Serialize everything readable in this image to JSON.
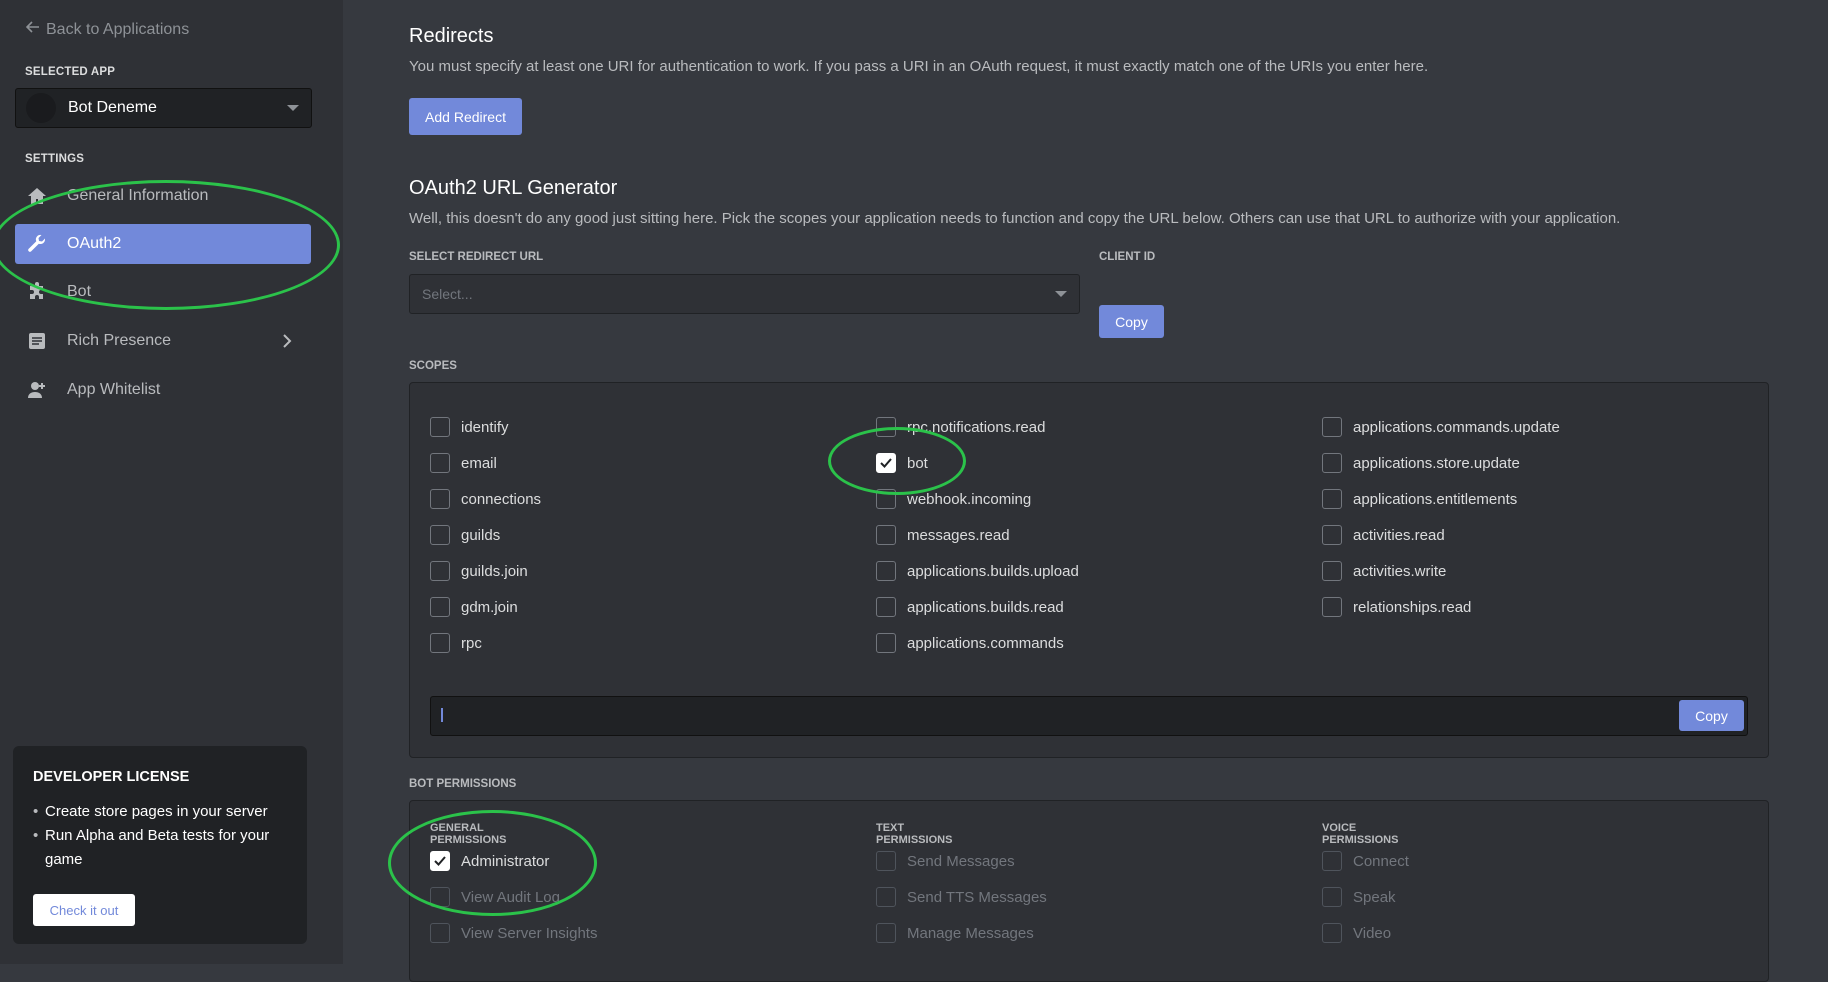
{
  "sidebar": {
    "back_label": "Back to Applications",
    "selected_app_label": "SELECTED APP",
    "app_name": "Bot Deneme",
    "settings_label": "SETTINGS",
    "items": [
      {
        "label": "General Information",
        "icon": "home-icon"
      },
      {
        "label": "OAuth2",
        "icon": "wrench-icon",
        "active": true
      },
      {
        "label": "Bot",
        "icon": "puzzle-icon"
      },
      {
        "label": "Rich Presence",
        "icon": "document-icon"
      },
      {
        "label": "App Whitelist",
        "icon": "person-add-icon"
      }
    ],
    "dev_license": {
      "title": "DEVELOPER LICENSE",
      "bullets": [
        "Create store pages in your server",
        "Run Alpha and Beta tests for your game"
      ],
      "button": "Check it out"
    }
  },
  "redirects": {
    "title": "Redirects",
    "description": "You must specify at least one URI for authentication to work. If you pass a URI in an OAuth request, it must exactly match one of the URIs you enter here.",
    "add_button": "Add Redirect"
  },
  "generator": {
    "title": "OAuth2 URL Generator",
    "description": "Well, this doesn't do any good just sitting here. Pick the scopes your application needs to function and copy the URL below. Others can use that URL to authorize with your application.",
    "redirect_label": "SELECT REDIRECT URL",
    "redirect_placeholder": "Select...",
    "client_id_label": "CLIENT ID",
    "copy_label": "Copy"
  },
  "scopes": {
    "label": "SCOPES",
    "columns": [
      [
        {
          "label": "identify",
          "checked": false
        },
        {
          "label": "email",
          "checked": false
        },
        {
          "label": "connections",
          "checked": false
        },
        {
          "label": "guilds",
          "checked": false
        },
        {
          "label": "guilds.join",
          "checked": false
        },
        {
          "label": "gdm.join",
          "checked": false
        },
        {
          "label": "rpc",
          "checked": false
        }
      ],
      [
        {
          "label": "rpc.notifications.read",
          "checked": false
        },
        {
          "label": "bot",
          "checked": true
        },
        {
          "label": "webhook.incoming",
          "checked": false
        },
        {
          "label": "messages.read",
          "checked": false
        },
        {
          "label": "applications.builds.upload",
          "checked": false
        },
        {
          "label": "applications.builds.read",
          "checked": false
        },
        {
          "label": "applications.commands",
          "checked": false
        }
      ],
      [
        {
          "label": "applications.commands.update",
          "checked": false
        },
        {
          "label": "applications.store.update",
          "checked": false
        },
        {
          "label": "applications.entitlements",
          "checked": false
        },
        {
          "label": "activities.read",
          "checked": false
        },
        {
          "label": "activities.write",
          "checked": false
        },
        {
          "label": "relationships.read",
          "checked": false
        }
      ]
    ],
    "url_copy_label": "Copy"
  },
  "bot_permissions": {
    "label": "BOT PERMISSIONS",
    "columns": [
      {
        "heading": "GENERAL PERMISSIONS",
        "items": [
          {
            "label": "Administrator",
            "checked": true,
            "enabled": true
          },
          {
            "label": "View Audit Log",
            "checked": false,
            "enabled": false
          },
          {
            "label": "View Server Insights",
            "checked": false,
            "enabled": false
          }
        ]
      },
      {
        "heading": "TEXT PERMISSIONS",
        "items": [
          {
            "label": "Send Messages",
            "checked": false,
            "enabled": false
          },
          {
            "label": "Send TTS Messages",
            "checked": false,
            "enabled": false
          },
          {
            "label": "Manage Messages",
            "checked": false,
            "enabled": false
          }
        ]
      },
      {
        "heading": "VOICE PERMISSIONS",
        "items": [
          {
            "label": "Connect",
            "checked": false,
            "enabled": false
          },
          {
            "label": "Speak",
            "checked": false,
            "enabled": false
          },
          {
            "label": "Video",
            "checked": false,
            "enabled": false
          }
        ]
      }
    ]
  },
  "colors": {
    "accent": "#7289da",
    "highlight": "#2bc24a"
  }
}
